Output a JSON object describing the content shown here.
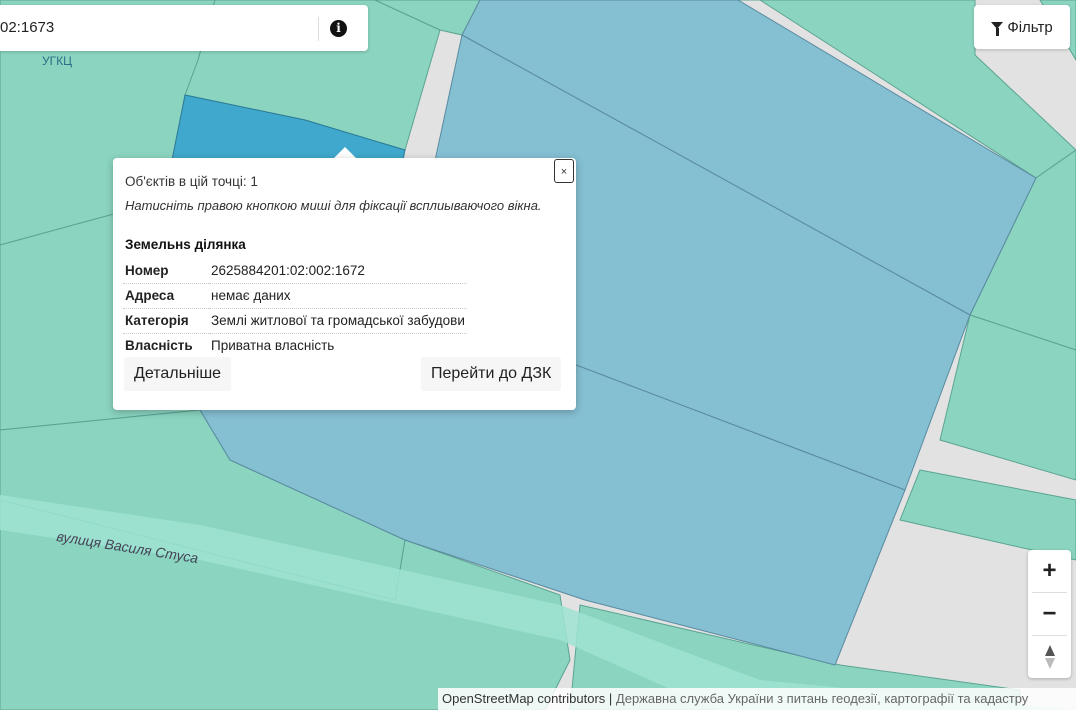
{
  "search": {
    "value": "02:1673"
  },
  "filter": {
    "label": "Фільтр",
    "icon": "filter-icon"
  },
  "map": {
    "street_label": "вулиця Василя Стуса",
    "place_label": "УГКЦ",
    "colors": {
      "background": "#e2e2e2",
      "parcel": "#8ad4c0",
      "parcel_border": "#5aa491",
      "selected_parcel": "#84bfd2",
      "highlight_parcel": "#3fa8cc"
    }
  },
  "popup": {
    "count_text": "Об'єктів в цій точці: 1",
    "hint": "Натисніть правою кнопкою миші для фіксації всплиываючого вікна.",
    "title": "Земельнs ділянка",
    "rows": [
      {
        "key": "Номер",
        "value": "2625884201:02:002:1672"
      },
      {
        "key": "Адреса",
        "value": "немає даних"
      },
      {
        "key": "Категорія",
        "value": "Землі житлової та громадської забудови"
      },
      {
        "key": "Власність",
        "value": "Приватна власність"
      }
    ],
    "details_btn": "Детальніше",
    "goto_btn": "Перейти до ДЗК",
    "close": "×"
  },
  "zoom": {
    "in": "+",
    "out": "−"
  },
  "attribution": {
    "osm": "OpenStreetMap contributors",
    "sep": " | ",
    "agency": "Державна служба України з питань геодезії, картографії та кадастру"
  }
}
